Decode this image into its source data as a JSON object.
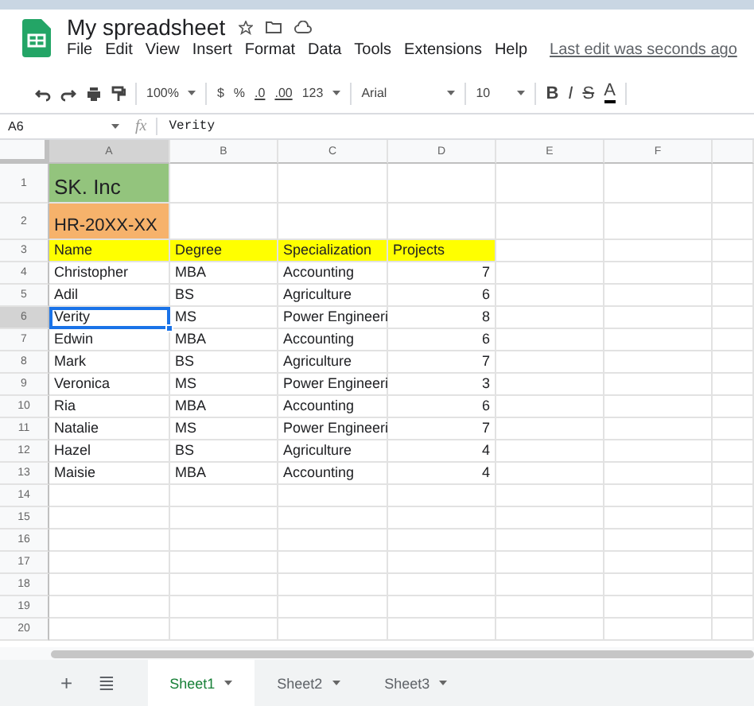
{
  "document": {
    "title": "My spreadsheet",
    "last_edit": "Last edit was seconds ago"
  },
  "menu": [
    "File",
    "Edit",
    "View",
    "Insert",
    "Format",
    "Data",
    "Tools",
    "Extensions",
    "Help"
  ],
  "toolbar": {
    "zoom": "100%",
    "currency": "$",
    "percent": "%",
    "decrease_decimals": ".0",
    "increase_decimals": ".00",
    "more_formats": "123",
    "font": "Arial",
    "font_size": "10",
    "bold": "B",
    "italic": "I",
    "strikethrough": "S",
    "text_color": "A"
  },
  "formula_bar": {
    "cell_ref": "A6",
    "function_label": "fx",
    "value": "Verity"
  },
  "columns": [
    {
      "label": "A",
      "selected": true
    },
    {
      "label": "B",
      "selected": false
    },
    {
      "label": "C",
      "selected": false
    },
    {
      "label": "D",
      "selected": false
    },
    {
      "label": "E",
      "selected": false
    },
    {
      "label": "F",
      "selected": false
    },
    {
      "selected": false
    }
  ],
  "rows": [
    {
      "number": "1",
      "kind": "title",
      "color": "#93c47d",
      "selected": false,
      "cells": [
        "SK. Inc"
      ]
    },
    {
      "number": "2",
      "kind": "subtitle",
      "color": "#f6b26b",
      "selected": false,
      "cells": [
        "HR-20XX-XX"
      ]
    },
    {
      "number": "3",
      "kind": "header",
      "color": "#ffff00",
      "selected": false,
      "cells": [
        "Name",
        "Degree",
        "Specialization",
        "Projects"
      ]
    },
    {
      "number": "4",
      "kind": "data",
      "selected": false,
      "cells": [
        "Christopher",
        "MBA",
        "Accounting",
        "7"
      ]
    },
    {
      "number": "5",
      "kind": "data",
      "selected": false,
      "cells": [
        "Adil",
        "BS",
        "Agriculture",
        "6"
      ]
    },
    {
      "number": "6",
      "kind": "data",
      "selected": true,
      "cells": [
        "Verity",
        "MS",
        "Power Engineeri",
        "8"
      ]
    },
    {
      "number": "7",
      "kind": "data",
      "selected": false,
      "cells": [
        "Edwin",
        "MBA",
        "Accounting",
        "6"
      ]
    },
    {
      "number": "8",
      "kind": "data",
      "selected": false,
      "cells": [
        "Mark",
        "BS",
        "Agriculture",
        "7"
      ]
    },
    {
      "number": "9",
      "kind": "data",
      "selected": false,
      "cells": [
        "Veronica",
        "MS",
        "Power Engineeri",
        "3"
      ]
    },
    {
      "number": "10",
      "kind": "data",
      "selected": false,
      "cells": [
        "Ria",
        "MBA",
        "Accounting",
        "6"
      ]
    },
    {
      "number": "11",
      "kind": "data",
      "selected": false,
      "cells": [
        "Natalie",
        "MS",
        "Power Engineeri",
        "7"
      ]
    },
    {
      "number": "12",
      "kind": "data",
      "selected": false,
      "cells": [
        "Hazel",
        "BS",
        "Agriculture",
        "4"
      ]
    },
    {
      "number": "13",
      "kind": "data",
      "selected": false,
      "cells": [
        "Maisie",
        "MBA",
        "Accounting",
        "4"
      ]
    },
    {
      "number": "14",
      "kind": "empty",
      "selected": false
    },
    {
      "number": "15",
      "kind": "empty",
      "selected": false
    },
    {
      "number": "16",
      "kind": "empty",
      "selected": false
    },
    {
      "number": "17",
      "kind": "empty",
      "selected": false
    },
    {
      "number": "18",
      "kind": "empty",
      "selected": false
    },
    {
      "number": "19",
      "kind": "empty",
      "selected": false
    },
    {
      "number": "20",
      "kind": "empty",
      "selected": false
    }
  ],
  "add_sheet": "+",
  "all_sheets": "≣",
  "sheets": [
    {
      "label": "Sheet1",
      "selected": true
    },
    {
      "label": "Sheet2",
      "selected": false
    },
    {
      "label": "Sheet3",
      "selected": false
    }
  ]
}
